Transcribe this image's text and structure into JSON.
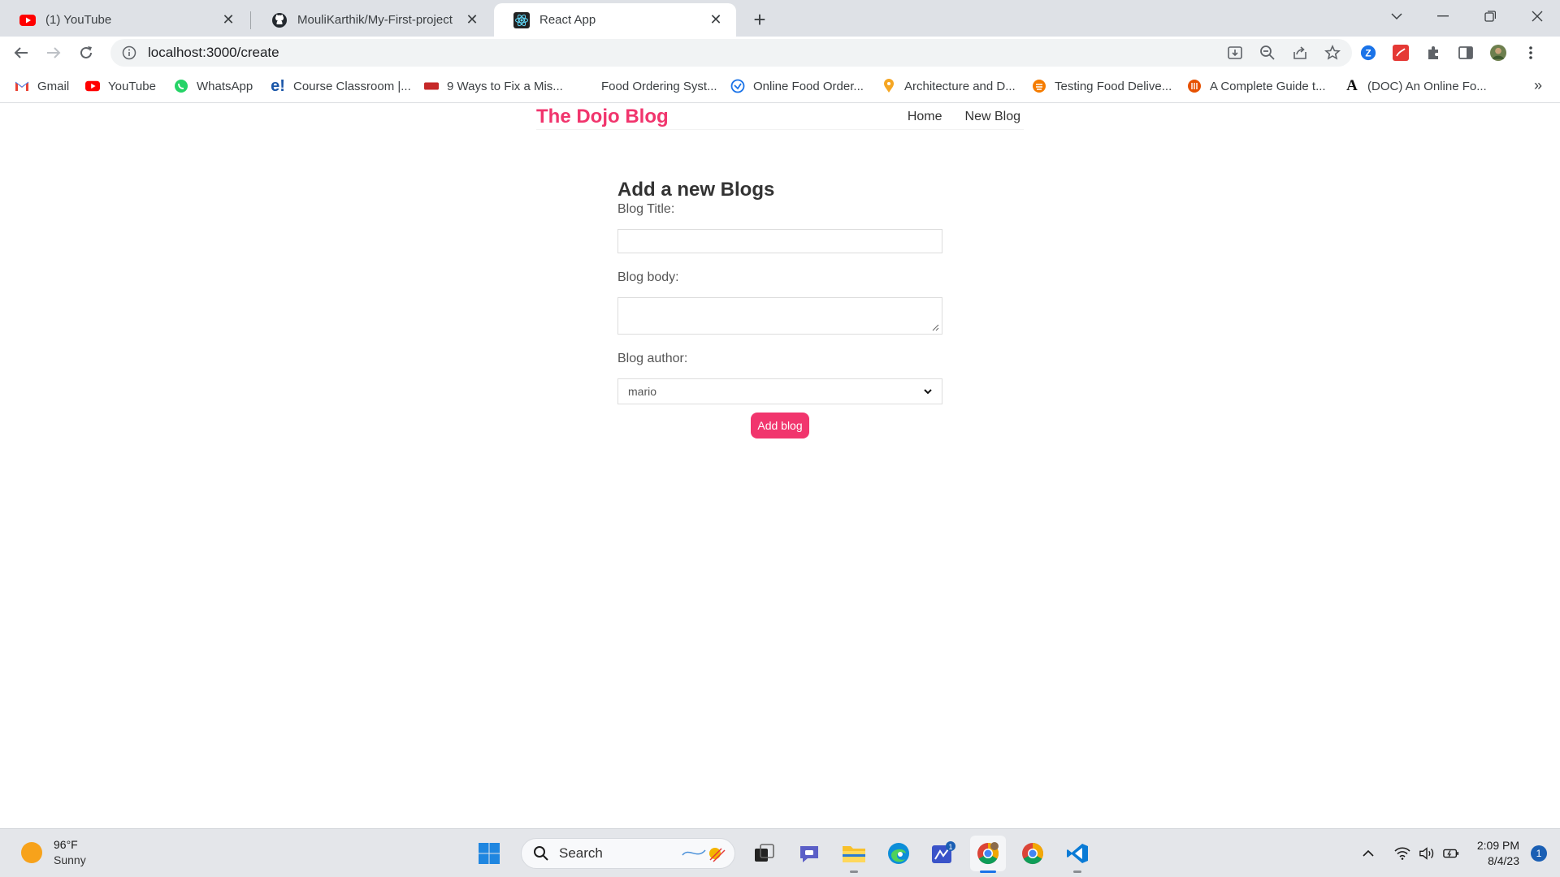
{
  "browser": {
    "tabs": [
      {
        "title": "(1) YouTube",
        "icon": "youtube-icon",
        "active": false
      },
      {
        "title": "MouliKarthik/My-First-project",
        "icon": "github-icon",
        "active": false
      },
      {
        "title": "React App",
        "icon": "react-icon",
        "active": true
      }
    ],
    "url": "localhost:3000/create",
    "bookmarks": [
      {
        "label": "Gmail",
        "icon": "gmail-icon"
      },
      {
        "label": "YouTube",
        "icon": "youtube-icon"
      },
      {
        "label": "WhatsApp",
        "icon": "whatsapp-icon"
      },
      {
        "label": "Course Classroom |...",
        "icon": "course-icon"
      },
      {
        "label": "9 Ways to Fix a Mis...",
        "icon": "article-icon"
      },
      {
        "label": "Food Ordering Syst...",
        "icon": "none"
      },
      {
        "label": "Online Food Order...",
        "icon": "globe-icon"
      },
      {
        "label": "Architecture and D...",
        "icon": "pin-icon"
      },
      {
        "label": "Testing Food Delive...",
        "icon": "food-icon"
      },
      {
        "label": "A Complete Guide t...",
        "icon": "guide-icon"
      },
      {
        "label": "(DOC) An Online Fo...",
        "icon": "academia-icon"
      }
    ],
    "more_bookmarks": "»"
  },
  "app": {
    "brand": "The Dojo Blog",
    "nav": {
      "home": "Home",
      "new_blog": "New Blog"
    },
    "form": {
      "heading": "Add a new Blogs",
      "title_label": "Blog Title:",
      "title_value": "",
      "body_label": "Blog body:",
      "body_value": "",
      "author_label": "Blog author:",
      "author_value": "mario",
      "submit": "Add blog"
    },
    "colors": {
      "accent": "#f1356d"
    }
  },
  "taskbar": {
    "weather": {
      "temp": "96°F",
      "condition": "Sunny"
    },
    "search_placeholder": "Search",
    "time": "2:09 PM",
    "date": "8/4/23",
    "notification_count": "1",
    "edge_badge": "1"
  }
}
